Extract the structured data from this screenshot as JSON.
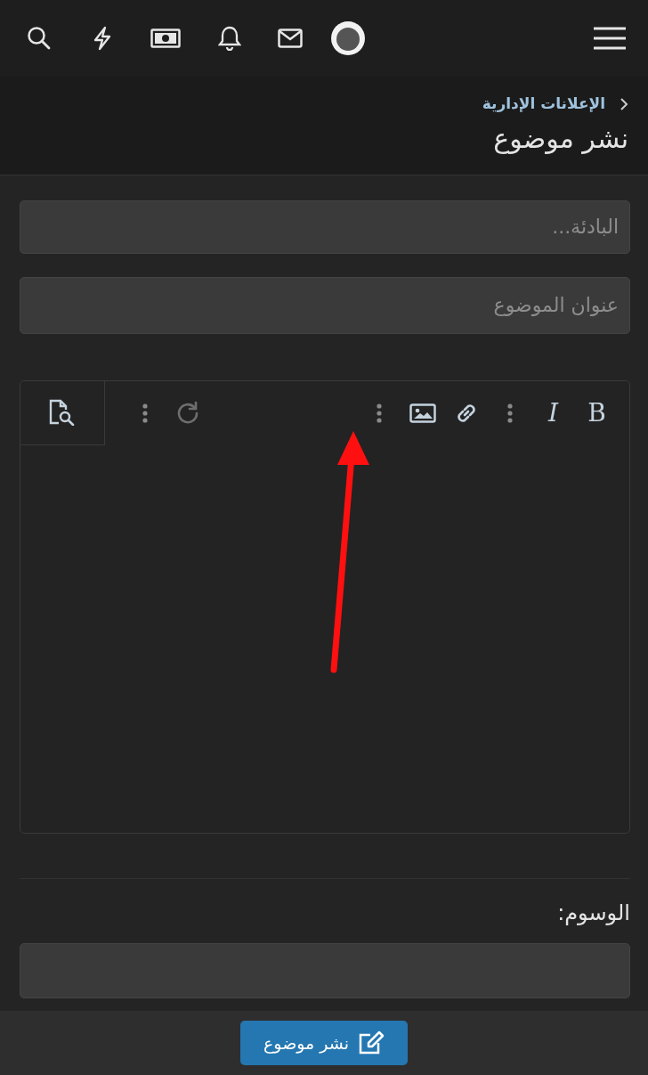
{
  "breadcrumb": {
    "label": "الإعلانات الإدارية"
  },
  "page_title": "نشر موضوع",
  "fields": [
    {
      "placeholder": "البادئة..."
    },
    {
      "placeholder": "عنوان الموضوع"
    }
  ],
  "toolbar": [
    {
      "kind": "text",
      "label": "B",
      "disabled": false
    },
    {
      "kind": "text",
      "label": "I",
      "disabled": false
    },
    {
      "kind": "more",
      "disabled": false
    },
    {
      "kind": "link",
      "disabled": false
    },
    {
      "kind": "image",
      "disabled": false
    },
    {
      "kind": "more",
      "disabled": false
    },
    {
      "kind": "gap"
    },
    {
      "kind": "redo",
      "disabled": true
    },
    {
      "kind": "more",
      "disabled": false
    }
  ],
  "tags": {
    "label": "الوسوم:"
  },
  "submit": {
    "label": "نشر موضوع"
  }
}
